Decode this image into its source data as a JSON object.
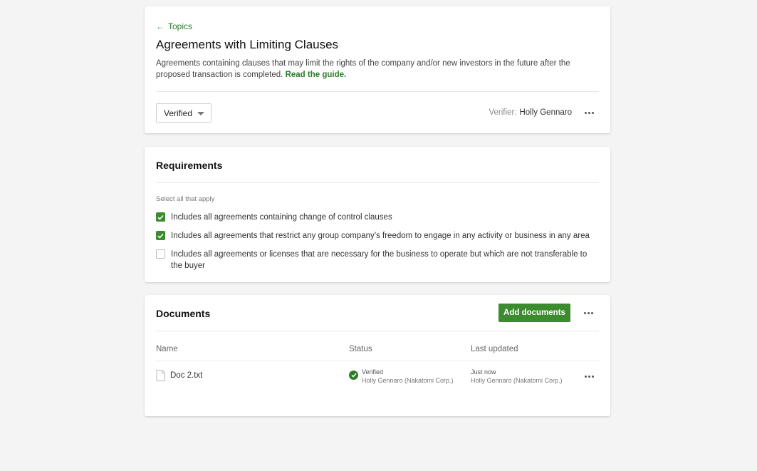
{
  "topic": {
    "back_label": "Topics",
    "title": "Agreements with Limiting Clauses",
    "description": "Agreements containing clauses that may limit the rights of the company and/or new investors in the future after the proposed transaction is completed.",
    "guide_link": "Read the guide.",
    "status_value": "Verified",
    "verifier_label": "Verifier:",
    "verifier_name": "Holly Gennaro"
  },
  "requirements": {
    "title": "Requirements",
    "hint": "Select all that apply",
    "items": [
      {
        "label": "Includes all agreements containing change of control clauses",
        "checked": true
      },
      {
        "label": "Includes all agreements that restrict any group company’s freedom to engage in any activity or business in any area",
        "checked": true
      },
      {
        "label": "Includes all agreements or licenses that are necessary for the business to operate but which are not transferable to the buyer",
        "checked": false
      }
    ]
  },
  "documents": {
    "title": "Documents",
    "add_button": "Add documents",
    "columns": [
      "Name",
      "Status",
      "Last updated"
    ],
    "rows": [
      {
        "name": "Doc 2.txt",
        "status": "Verified",
        "status_by": "Holly Gennaro (Nakatomi Corp.)",
        "updated": "Just now",
        "updated_by": "Holly Gennaro (Nakatomi Corp.)"
      }
    ]
  },
  "colors": {
    "accent": "#3d8b2f",
    "link": "#2b7a2b",
    "background": "#f4f4f4"
  },
  "icons": {
    "back": "arrow-left-icon",
    "more": "more-horizontal-icon",
    "file": "file-icon",
    "verified": "check-circle-icon",
    "caret": "caret-down-icon"
  }
}
